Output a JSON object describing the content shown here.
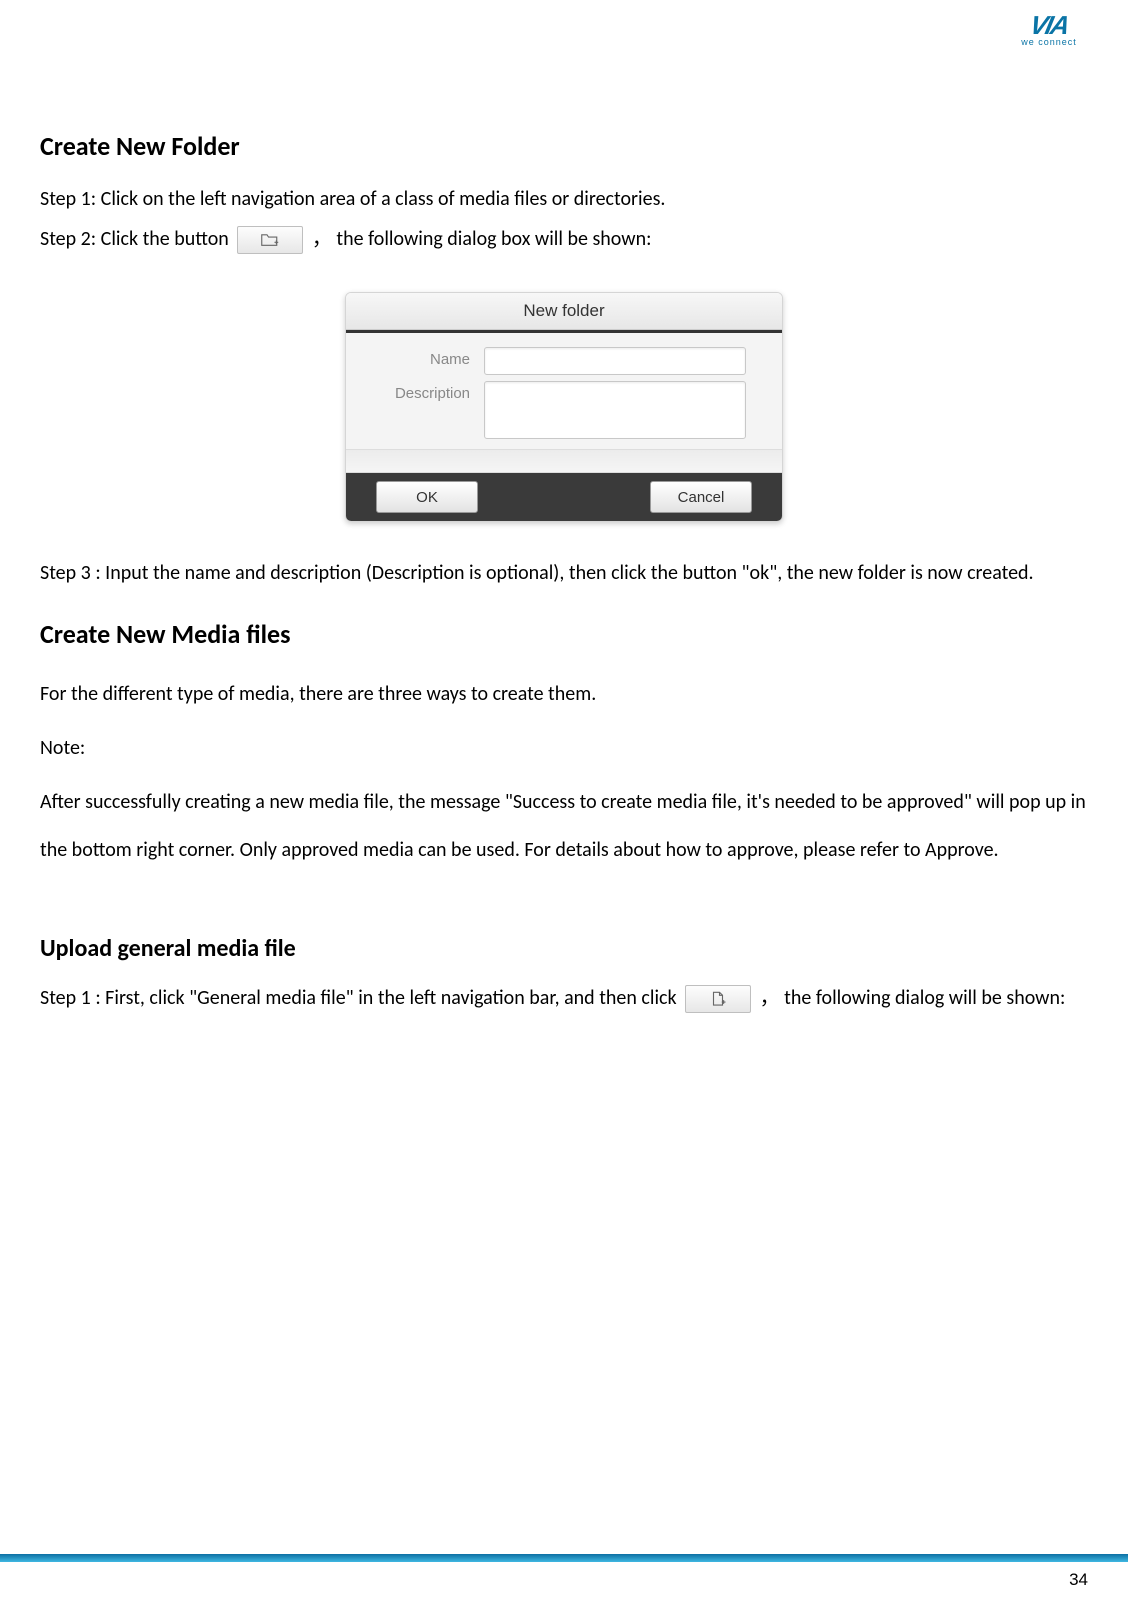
{
  "logo": {
    "top": "VIA",
    "sub": "we connect"
  },
  "section1": {
    "heading": "Create New Folder",
    "step1": "Step 1: Click on the left navigation area of a class of media files or directories.",
    "step2_pre": "Step 2: Click the button",
    "step2_post": "， the following dialog box will be shown:",
    "step3": "Step 3 : Input the name and description (Description is optional), then click the button \"ok\", the new folder is now created."
  },
  "dialog": {
    "title": "New folder",
    "name_label": "Name",
    "desc_label": "Description",
    "ok": "OK",
    "cancel": "Cancel"
  },
  "section2": {
    "heading": "Create New Media files",
    "p1": "For the different type of media, there are three ways to create them.",
    "note_label": "Note:",
    "note_body": "After successfully creating a new media file, the message \"Success to create media file, it's needed to be approved\" will pop up in the bottom right corner. Only approved media can be used. For details about how to approve, please refer to Approve."
  },
  "section3": {
    "heading": "Upload general media file",
    "step1_pre": "Step 1 : First, click \"General media file\" in the left navigation bar, and then click ",
    "step1_post": "， the following dialog will be shown:"
  },
  "page_number": "34"
}
